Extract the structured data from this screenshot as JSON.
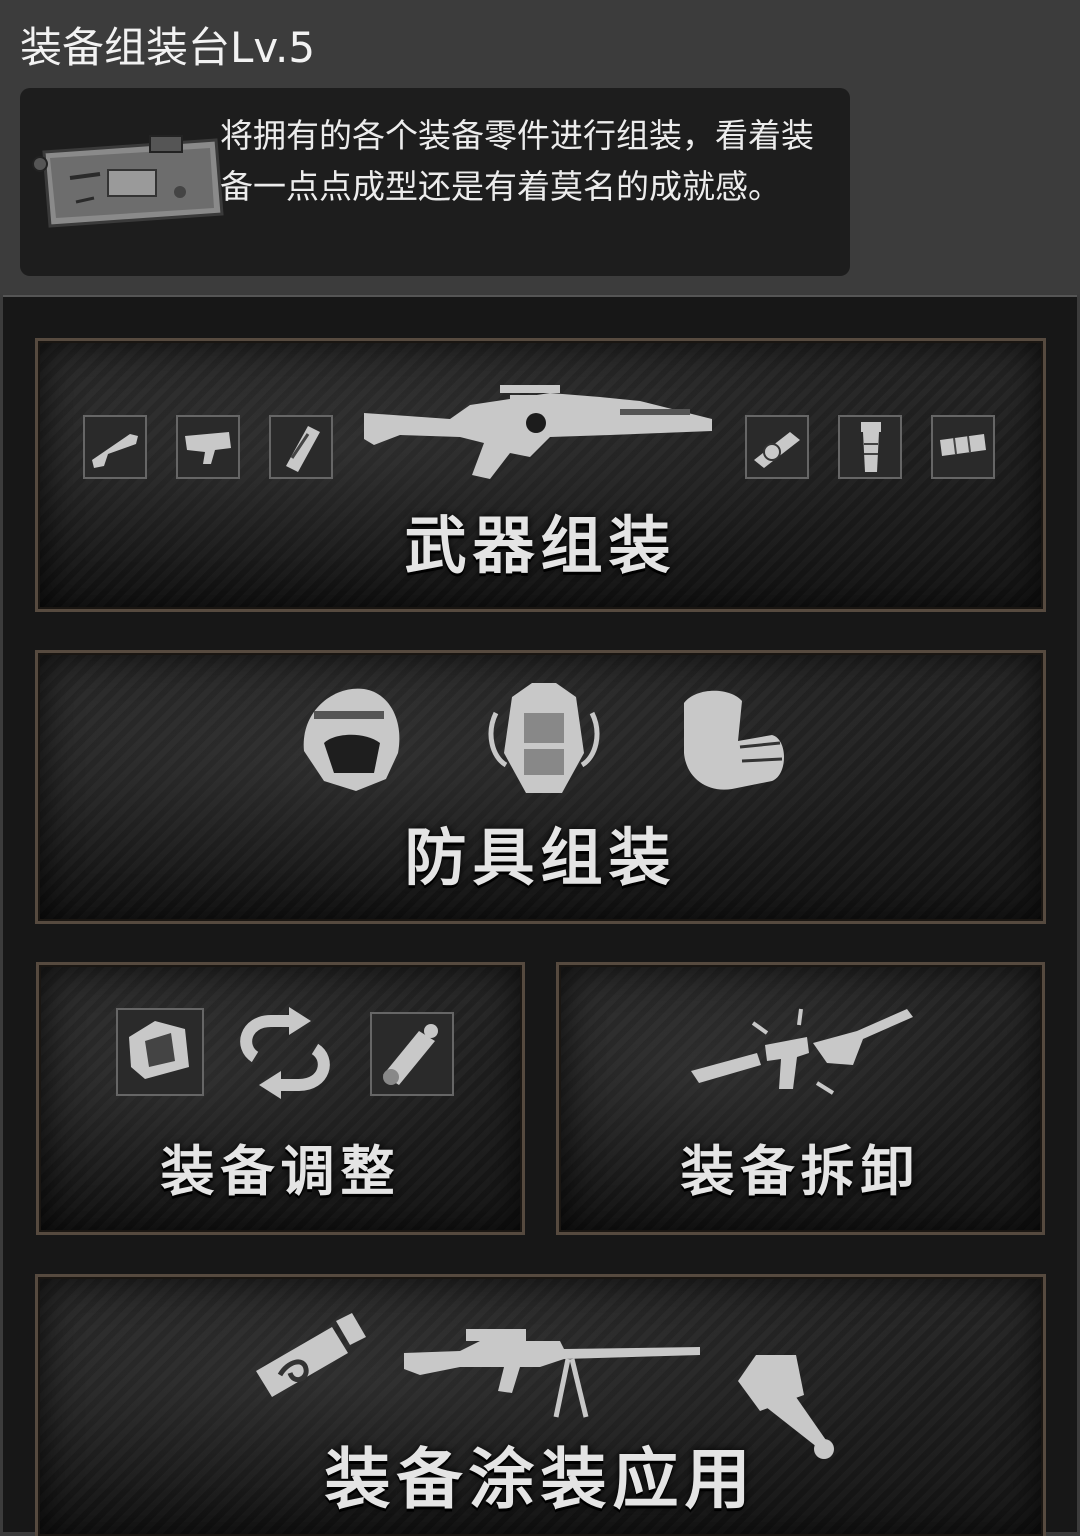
{
  "header": {
    "title": "装备组装台Lv.5",
    "description": "将拥有的各个装备零件进行组装，看着装备一点点成型还是有着莫名的成就感。"
  },
  "menu": {
    "weapon_assembly": {
      "label": "武器组装",
      "icons": [
        "stock-part-icon",
        "trigger-part-icon",
        "magazine-part-icon",
        "rifle-icon",
        "scope-part-icon",
        "grip-part-icon",
        "muzzle-part-icon"
      ]
    },
    "armor_assembly": {
      "label": "防具组装",
      "icons": [
        "helmet-icon",
        "vest-icon",
        "glove-icon"
      ]
    },
    "equipment_adjust": {
      "label": "装备调整",
      "icons": [
        "red-dot-sight-icon",
        "swap-arrows-icon",
        "thermal-scope-icon"
      ]
    },
    "equipment_disassemble": {
      "label": "装备拆卸",
      "icons": [
        "broken-rifle-icon"
      ]
    },
    "equipment_paint": {
      "label": "装备涂装应用",
      "icons": [
        "spray-can-icon",
        "sniper-rifle-icon",
        "paint-brush-icon"
      ]
    }
  },
  "colors": {
    "card_border": "#564a3f",
    "icon_fill": "#c8c8c8",
    "panel_bg": "#171717"
  }
}
